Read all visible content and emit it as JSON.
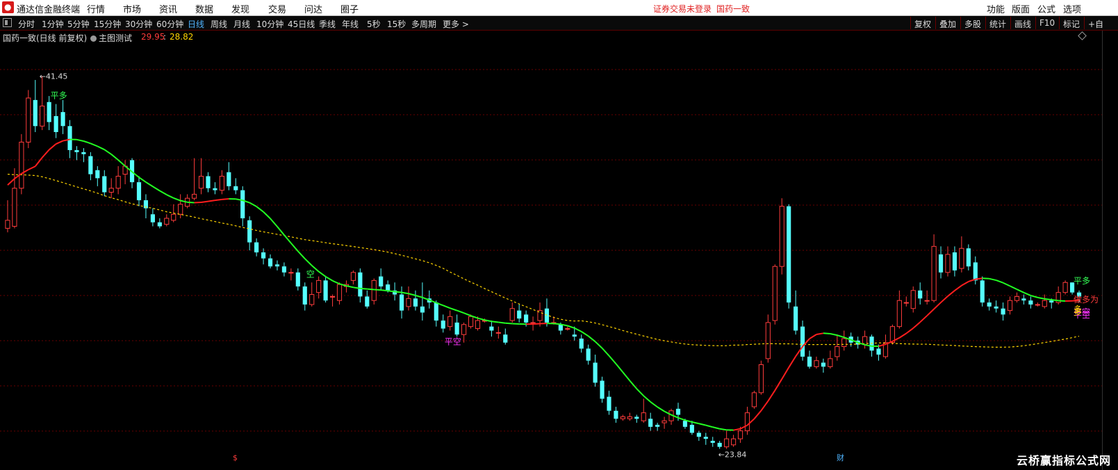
{
  "app": {
    "title": "通达信金融终端",
    "menu": [
      "行情",
      "市场",
      "资讯",
      "数据",
      "发现",
      "交易",
      "问达",
      "圈子"
    ],
    "notice": "证券交易未登录",
    "stock_name": "国药一致",
    "right_menu": [
      "功能",
      "版面",
      "公式",
      "选项"
    ]
  },
  "toolbar": {
    "periods": [
      "分时",
      "1分钟",
      "5分钟",
      "15分钟",
      "30分钟",
      "60分钟",
      "日线",
      "周线",
      "月线",
      "10分钟",
      "45日线",
      "季线",
      "年线",
      "5秒",
      "15秒",
      "多周期",
      "更多 >"
    ],
    "active_period": "日线",
    "tools": [
      "复权",
      "叠加",
      "多股",
      "统计",
      "画线",
      "F10",
      "标记",
      "+自"
    ]
  },
  "chart_header": {
    "title": "国药一致(日线 前复权)",
    "indicator": "主图测试",
    "value1": "29.95",
    "separator": ":",
    "value2": "28.82"
  },
  "colors": {
    "up": "#ff3c3c",
    "down": "#55ffff",
    "ma_green": "#22ff22",
    "ma_red": "#ff1e1e",
    "ma_yellow": "#ffd400",
    "grid": "#6a0000",
    "label_cyan_green": "#33ff55",
    "label_magenta": "#ff33ff"
  },
  "chart_data": {
    "type": "candlestick",
    "ylim": [
      22.4,
      43.0
    ],
    "high_label": "41.45",
    "low_label": "23.84",
    "candles": [
      [
        33.9,
        34.3,
        33.7,
        35.3
      ],
      [
        34.0,
        35.9,
        33.9,
        36.9
      ],
      [
        35.9,
        38.2,
        35.6,
        38.6
      ],
      [
        38.2,
        40.4,
        37.9,
        40.8
      ],
      [
        40.3,
        39.0,
        38.7,
        41.3
      ],
      [
        39.0,
        40.0,
        38.8,
        41.5
      ],
      [
        40.2,
        39.2,
        38.8,
        40.5
      ],
      [
        39.5,
        38.7,
        38.4,
        40.1
      ],
      [
        39.7,
        39.0,
        38.6,
        40.3
      ],
      [
        39.0,
        37.8,
        37.4,
        39.3
      ],
      [
        37.8,
        37.7,
        37.3,
        38.0
      ],
      [
        37.7,
        37.6,
        37.2,
        37.9
      ],
      [
        37.5,
        36.6,
        36.3,
        37.7
      ],
      [
        36.8,
        36.4,
        36.0,
        37.0
      ],
      [
        36.5,
        35.7,
        35.5,
        36.8
      ],
      [
        35.7,
        35.9,
        35.4,
        36.4
      ],
      [
        35.9,
        36.5,
        35.6,
        37.0
      ],
      [
        36.6,
        37.0,
        36.1,
        37.3
      ],
      [
        37.3,
        36.2,
        35.9,
        37.4
      ],
      [
        36.2,
        35.3,
        35.0,
        36.5
      ],
      [
        35.3,
        34.9,
        34.4,
        35.6
      ],
      [
        34.6,
        34.2,
        34.0,
        34.9
      ],
      [
        34.2,
        34.0,
        33.9,
        34.4
      ],
      [
        34.1,
        34.4,
        34.0,
        34.6
      ],
      [
        34.3,
        34.6,
        34.2,
        35.1
      ],
      [
        34.6,
        35.1,
        34.4,
        35.6
      ],
      [
        35.0,
        35.4,
        34.9,
        35.6
      ],
      [
        35.4,
        35.6,
        35.3,
        37.4
      ],
      [
        35.9,
        36.5,
        35.6,
        37.4
      ],
      [
        36.5,
        35.9,
        35.7,
        36.7
      ],
      [
        35.9,
        35.8,
        35.6,
        36.2
      ],
      [
        35.8,
        36.5,
        35.6,
        36.8
      ],
      [
        36.7,
        36.0,
        35.8,
        37.2
      ],
      [
        36.0,
        35.8,
        35.6,
        36.4
      ],
      [
        35.8,
        34.4,
        34.0,
        36.0
      ],
      [
        34.3,
        33.2,
        32.8,
        34.5
      ],
      [
        33.2,
        32.7,
        32.5,
        33.4
      ],
      [
        32.7,
        32.4,
        32.1,
        32.9
      ],
      [
        32.4,
        32.0,
        31.9,
        32.6
      ],
      [
        32.1,
        32.0,
        31.8,
        32.3
      ],
      [
        32.0,
        31.7,
        31.5,
        32.2
      ],
      [
        31.7,
        31.7,
        31.3,
        31.9
      ],
      [
        31.7,
        31.0,
        30.8,
        31.9
      ],
      [
        31.0,
        30.1,
        29.8,
        31.2
      ],
      [
        30.1,
        30.6,
        30.0,
        31.2
      ],
      [
        30.7,
        31.3,
        30.4,
        31.5
      ],
      [
        31.3,
        30.3,
        30.2,
        31.5
      ],
      [
        30.5,
        30.5,
        30.0,
        30.6
      ],
      [
        30.3,
        31.1,
        30.1,
        31.2
      ],
      [
        31.0,
        31.1,
        30.7,
        31.3
      ],
      [
        31.3,
        31.7,
        31.1,
        31.8
      ],
      [
        31.7,
        30.5,
        30.2,
        31.9
      ],
      [
        30.5,
        30.0,
        29.9,
        30.8
      ],
      [
        30.3,
        31.3,
        30.1,
        31.4
      ],
      [
        31.5,
        31.0,
        30.8,
        31.9
      ],
      [
        31.1,
        30.8,
        30.7,
        31.3
      ],
      [
        30.8,
        30.6,
        30.3,
        31.2
      ],
      [
        30.6,
        29.8,
        29.4,
        31.0
      ],
      [
        30.0,
        30.4,
        29.8,
        31.0
      ],
      [
        30.4,
        30.0,
        29.8,
        30.8
      ],
      [
        30.0,
        29.7,
        29.3,
        31.2
      ],
      [
        30.4,
        30.2,
        29.9,
        30.8
      ],
      [
        30.2,
        29.3,
        29.0,
        30.3
      ],
      [
        29.3,
        28.9,
        28.7,
        29.6
      ],
      [
        29.0,
        29.5,
        28.8,
        29.8
      ],
      [
        29.2,
        28.6,
        28.5,
        29.6
      ],
      [
        28.6,
        29.1,
        28.2,
        29.2
      ],
      [
        29.0,
        29.5,
        28.9,
        29.6
      ],
      [
        28.9,
        29.3,
        28.8,
        29.5
      ],
      [
        29.3,
        29.3,
        29.2,
        29.4
      ],
      [
        29.0,
        28.8,
        28.5,
        29.3
      ],
      [
        28.7,
        28.7,
        28.4,
        29.0
      ],
      [
        28.6,
        28.2,
        28.1,
        28.9
      ],
      [
        29.3,
        29.9,
        29.2,
        30.2
      ],
      [
        29.8,
        29.4,
        29.2,
        30.1
      ],
      [
        29.6,
        29.2,
        29.0,
        29.8
      ],
      [
        29.2,
        29.2,
        28.8,
        29.5
      ],
      [
        29.3,
        29.8,
        29.0,
        30.2
      ],
      [
        29.9,
        29.2,
        29.0,
        30.4
      ],
      [
        29.2,
        29.2,
        29.1,
        29.5
      ],
      [
        29.1,
        28.8,
        28.6,
        29.2
      ],
      [
        28.9,
        28.9,
        28.8,
        29.0
      ],
      [
        28.6,
        28.5,
        28.3,
        29.0
      ],
      [
        28.4,
        27.9,
        27.7,
        28.6
      ],
      [
        27.9,
        27.3,
        27.1,
        28.1
      ],
      [
        27.2,
        26.2,
        26.0,
        27.6
      ],
      [
        26.3,
        25.4,
        25.2,
        26.5
      ],
      [
        25.5,
        24.8,
        24.6,
        25.8
      ],
      [
        24.8,
        24.4,
        24.2,
        25.0
      ],
      [
        24.4,
        24.5,
        24.3,
        24.6
      ],
      [
        24.4,
        24.5,
        24.3,
        24.7
      ],
      [
        24.5,
        24.4,
        24.2,
        24.6
      ],
      [
        24.3,
        24.7,
        24.2,
        25.4
      ],
      [
        24.4,
        24.0,
        23.8,
        24.7
      ],
      [
        24.1,
        24.0,
        23.8,
        24.2
      ],
      [
        24.2,
        24.3,
        23.9,
        24.5
      ],
      [
        24.3,
        24.8,
        24.1,
        24.9
      ],
      [
        24.9,
        24.6,
        24.3,
        25.2
      ],
      [
        24.3,
        24.0,
        23.9,
        24.4
      ],
      [
        24.1,
        23.7,
        23.6,
        24.3
      ],
      [
        23.7,
        23.5,
        23.3,
        23.8
      ],
      [
        23.5,
        23.4,
        23.1,
        23.7
      ],
      [
        23.3,
        23.2,
        23.0,
        23.5
      ],
      [
        23.2,
        23.0,
        22.9,
        23.3
      ],
      [
        23.0,
        23.4,
        22.9,
        23.8
      ],
      [
        23.1,
        23.4,
        23.0,
        23.6
      ],
      [
        23.4,
        23.8,
        23.2,
        24.0
      ],
      [
        23.8,
        24.7,
        23.6,
        25.0
      ],
      [
        25.0,
        25.7,
        24.9,
        25.8
      ],
      [
        25.7,
        27.1,
        25.6,
        27.3
      ],
      [
        27.4,
        29.2,
        27.2,
        29.6
      ],
      [
        29.3,
        32.0,
        29.1,
        32.1
      ],
      [
        32.0,
        35.0,
        31.6,
        35.4
      ],
      [
        35.0,
        30.2,
        29.9,
        35.1
      ],
      [
        30.0,
        28.8,
        28.6,
        30.8
      ],
      [
        29.0,
        27.5,
        27.3,
        29.3
      ],
      [
        27.5,
        27.0,
        26.9,
        27.8
      ],
      [
        27.0,
        27.3,
        26.9,
        27.5
      ],
      [
        27.2,
        27.0,
        26.7,
        27.4
      ],
      [
        27.0,
        27.4,
        26.9,
        27.8
      ],
      [
        27.5,
        28.0,
        27.3,
        28.6
      ],
      [
        28.0,
        28.4,
        27.8,
        28.8
      ],
      [
        28.5,
        28.2,
        28.0,
        28.7
      ],
      [
        28.3,
        28.1,
        27.9,
        28.5
      ],
      [
        28.1,
        28.5,
        27.9,
        28.8
      ],
      [
        28.5,
        27.8,
        27.5,
        28.6
      ],
      [
        27.9,
        27.6,
        27.3,
        28.1
      ],
      [
        27.5,
        28.2,
        27.4,
        28.6
      ],
      [
        28.2,
        29.0,
        28.1,
        29.1
      ],
      [
        29.0,
        30.3,
        28.9,
        30.8
      ],
      [
        30.2,
        30.2,
        30.0,
        30.5
      ],
      [
        29.9,
        30.8,
        29.7,
        31.0
      ],
      [
        30.8,
        30.4,
        30.1,
        31.2
      ],
      [
        30.3,
        30.3,
        30.1,
        30.8
      ],
      [
        30.3,
        33.0,
        30.2,
        33.6
      ],
      [
        32.6,
        31.7,
        31.4,
        33.0
      ],
      [
        31.7,
        32.6,
        31.5,
        33.0
      ],
      [
        32.7,
        31.8,
        31.5,
        33.0
      ],
      [
        31.9,
        32.9,
        31.7,
        33.5
      ],
      [
        32.9,
        32.0,
        31.8,
        33.1
      ],
      [
        32.2,
        31.3,
        31.1,
        32.5
      ],
      [
        31.3,
        30.2,
        30.0,
        31.5
      ],
      [
        30.2,
        30.0,
        29.8,
        30.4
      ],
      [
        30.0,
        29.9,
        29.7,
        30.3
      ],
      [
        29.9,
        29.6,
        29.3,
        30.2
      ],
      [
        29.8,
        30.3,
        29.6,
        30.5
      ],
      [
        30.3,
        30.5,
        30.2,
        30.7
      ],
      [
        30.4,
        30.3,
        30.1,
        30.6
      ],
      [
        30.3,
        30.1,
        29.9,
        30.5
      ],
      [
        30.1,
        30.1,
        30.0,
        30.2
      ],
      [
        30.0,
        30.3,
        29.9,
        30.6
      ],
      [
        30.3,
        30.2,
        29.9,
        30.4
      ],
      [
        30.2,
        30.7,
        30.1,
        31.0
      ],
      [
        30.7,
        31.2,
        30.6,
        31.3
      ],
      [
        31.2,
        30.7,
        30.6,
        31.2
      ],
      [
        30.7,
        30.5,
        30.2,
        30.8
      ]
    ],
    "overlay_labels": [
      "平多",
      "空",
      "平空",
      "平空",
      "平空",
      "多",
      "平多",
      "做多为",
      "多",
      "平多"
    ],
    "bottom_marks": [
      "$",
      "财"
    ],
    "watermark": "云桥赢指标公式网"
  }
}
